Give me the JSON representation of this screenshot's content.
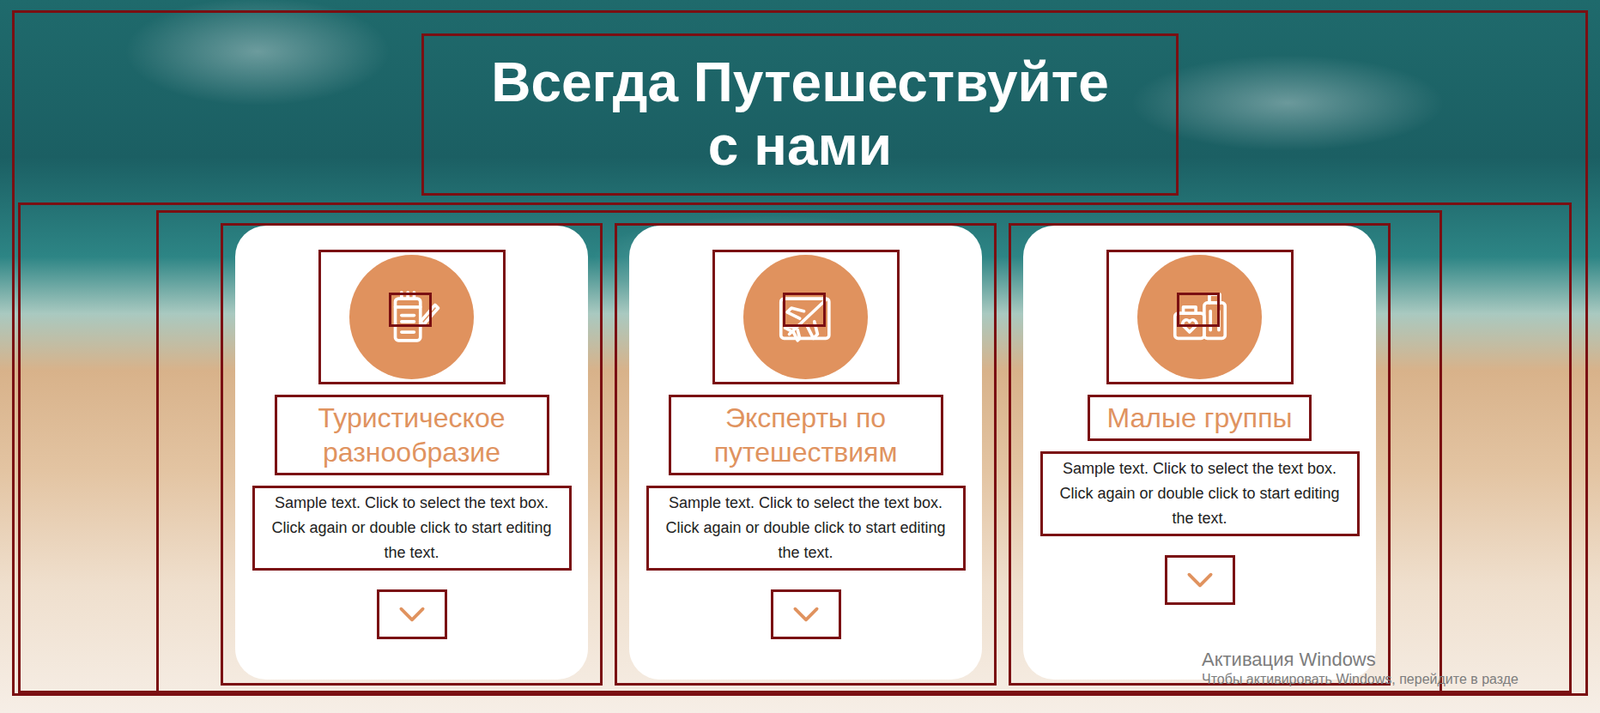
{
  "title": {
    "lines": [
      "Всегда Путешествуйте",
      "с нами"
    ]
  },
  "cards": [
    {
      "title": "Туристическое разнообразие",
      "text": "Sample text. Click to select the text box. Click again or double click to start editing the text."
    },
    {
      "title": "Эксперты по путешествиям",
      "text": "Sample text. Click to select the text box. Click again or double click to start editing the text."
    },
    {
      "title": "Малые группы",
      "text": "Sample text. Click to select the text box. Click again or double click to start editing the text."
    }
  ],
  "watermark": {
    "title": "Активация Windows",
    "subtitle": "Чтобы активировать Windows, перейдите в разде"
  }
}
